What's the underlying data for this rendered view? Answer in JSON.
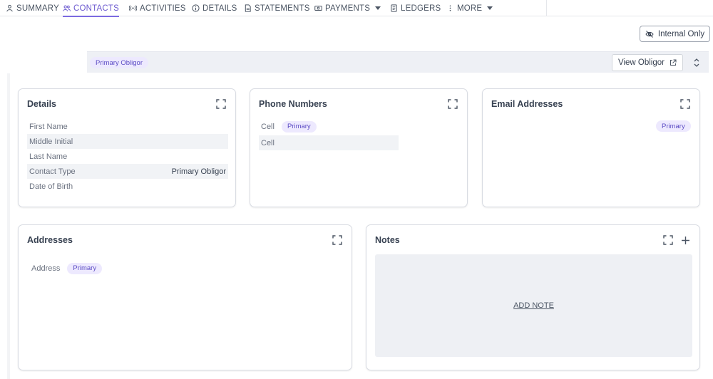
{
  "tabs": [
    {
      "label": "SUMMARY",
      "icon": "person-icon",
      "active": false
    },
    {
      "label": "CONTACTS",
      "icon": "people-icon",
      "active": true
    },
    {
      "label": "ACTIVITIES",
      "icon": "broadcast-icon",
      "active": false
    },
    {
      "label": "DETAILS",
      "icon": "info-icon",
      "active": false
    },
    {
      "label": "STATEMENTS",
      "icon": "document-icon",
      "active": false
    },
    {
      "label": "PAYMENTS",
      "icon": "cash-icon",
      "active": false,
      "has_dropdown": true
    },
    {
      "label": "LEDGERS",
      "icon": "ledger-icon",
      "active": false
    },
    {
      "label": "MORE",
      "icon": "vertical-dots-icon",
      "active": false,
      "has_dropdown": true
    }
  ],
  "internal_only": {
    "label": "Internal Only",
    "icon": "eye-off-icon"
  },
  "obligor_band": {
    "badge": "Primary Obligor",
    "view_button": "View Obligor",
    "view_icon": "external-link-icon",
    "toggle_icon": "chevron-up-down-icon"
  },
  "details_card": {
    "title": "Details",
    "rows": [
      {
        "label": "First Name",
        "value": ""
      },
      {
        "label": "Middle Initial",
        "value": ""
      },
      {
        "label": "Last Name",
        "value": ""
      },
      {
        "label": "Contact Type",
        "value": "Primary Obligor"
      },
      {
        "label": "Date of Birth",
        "value": ""
      }
    ]
  },
  "phone_card": {
    "title": "Phone Numbers",
    "rows": [
      {
        "label": "Cell",
        "badge": "Primary"
      },
      {
        "label": "Cell",
        "badge": ""
      }
    ]
  },
  "email_card": {
    "title": "Email Addresses",
    "badge": "Primary"
  },
  "addresses_card": {
    "title": "Addresses",
    "row": {
      "label": "Address",
      "badge": "Primary"
    }
  },
  "notes_card": {
    "title": "Notes",
    "add_note": "ADD NOTE"
  },
  "colors": {
    "accent": "#6d5bd0",
    "badge_bg": "#ede9fe",
    "badge_text": "#5b4bc4"
  }
}
